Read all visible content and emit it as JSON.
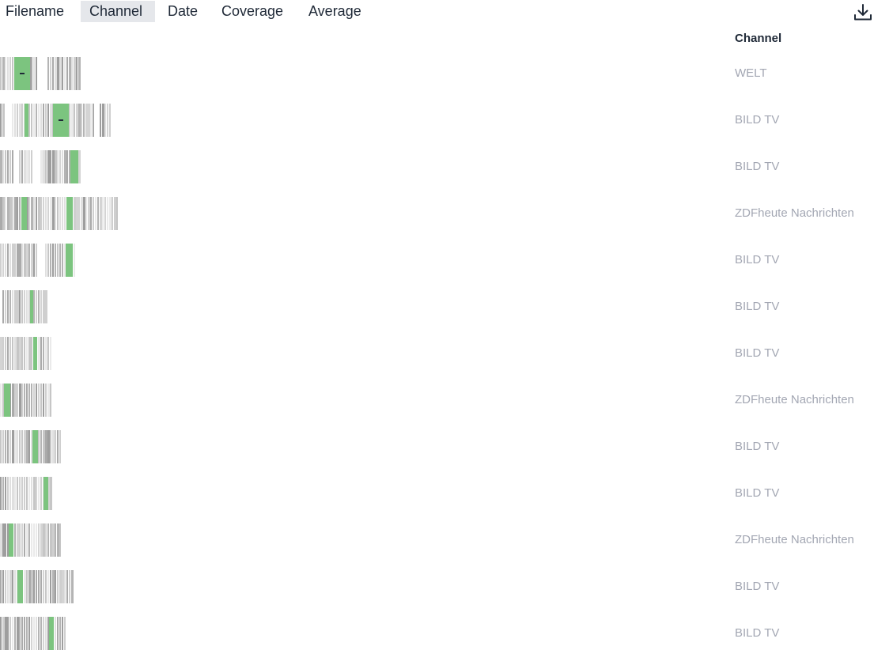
{
  "tabs": [
    {
      "label": "Filename",
      "active": false
    },
    {
      "label": "Channel",
      "active": true
    },
    {
      "label": "Date",
      "active": false
    },
    {
      "label": "Coverage",
      "active": false
    },
    {
      "label": "Average",
      "active": false
    }
  ],
  "toolbar": {
    "download_icon": "download-icon"
  },
  "table": {
    "column_header": "Channel",
    "rows": [
      {
        "channel": "WELT"
      },
      {
        "channel": "BILD TV"
      },
      {
        "channel": "BILD TV"
      },
      {
        "channel": "ZDFheute Nachrichten"
      },
      {
        "channel": "BILD TV"
      },
      {
        "channel": "BILD TV"
      },
      {
        "channel": "BILD TV"
      },
      {
        "channel": "ZDFheute Nachrichten"
      },
      {
        "channel": "BILD TV"
      },
      {
        "channel": "BILD TV"
      },
      {
        "channel": "ZDFheute Nachrichten"
      },
      {
        "channel": "BILD TV"
      },
      {
        "channel": "BILD TV"
      }
    ]
  },
  "colors": {
    "highlight": "#7cc47f",
    "stripe_dark": "#b0b0b0",
    "stripe_light": "#e4e4e4",
    "channel_text": "#a3a7b3",
    "active_tab_bg": "#e5e7eb"
  }
}
